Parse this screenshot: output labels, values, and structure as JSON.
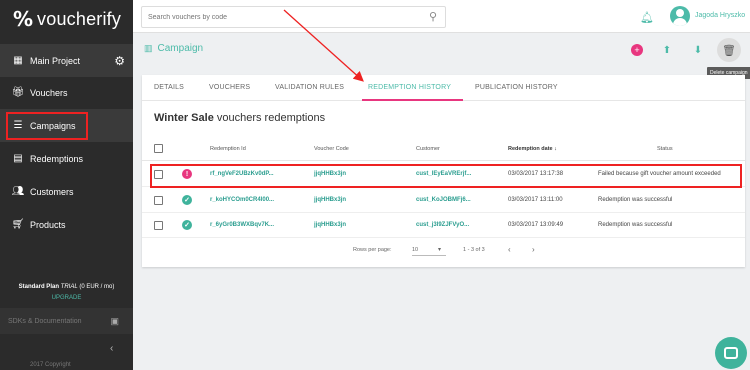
{
  "app": {
    "logo_mark": "%",
    "logo_text": "voucherify"
  },
  "sidebar": {
    "items": [
      {
        "label": "Main Project",
        "icon": "dashboard-icon"
      },
      {
        "label": "Vouchers",
        "icon": "gift-icon"
      },
      {
        "label": "Campaigns",
        "icon": "list-icon"
      },
      {
        "label": "Redemptions",
        "icon": "receipt-icon"
      },
      {
        "label": "Customers",
        "icon": "people-icon"
      },
      {
        "label": "Products",
        "icon": "cart-icon"
      }
    ],
    "plan_label": "Standard Plan",
    "plan_trial": "TRIAL",
    "plan_price": "(0 EUR / mo)",
    "upgrade": "UPGRADE",
    "sdk": "SDKs & Documentation",
    "copyright": "2017 Copyright"
  },
  "topbar": {
    "search_placeholder": "Search vouchers by code",
    "username": "Jagoda Hryszko"
  },
  "header": {
    "title": "Campaign",
    "tooltip": "Delete campaign"
  },
  "tabs": [
    "DETAILS",
    "VOUCHERS",
    "VALIDATION RULES",
    "REDEMPTION HISTORY",
    "PUBLICATION HISTORY"
  ],
  "active_tab": "REDEMPTION HISTORY",
  "card": {
    "title_bold": "Winter Sale",
    "title_rest": " vouchers redemptions"
  },
  "table": {
    "headers": {
      "redemption_id": "Redemption Id",
      "voucher_code": "Voucher Code",
      "customer": "Customer",
      "redemption_date": "Redemption date",
      "sort_icon": "↓",
      "status": "Status"
    },
    "rows": [
      {
        "status_type": "failed",
        "status_glyph": "!",
        "id": "rf_ngVeF2UBzKv0dP...",
        "code": "jjqHHBx3jn",
        "customer": "cust_lEyEaVRErjf...",
        "date": "03/03/2017 13:17:38",
        "status": "Failed because gift voucher amount exceeded"
      },
      {
        "status_type": "success",
        "status_glyph": "✓",
        "id": "r_koHYCOm0CR4l00...",
        "code": "jjqHHBx3jn",
        "customer": "cust_KoJOBMFj6...",
        "date": "03/03/2017 13:11:00",
        "status": "Redemption was successful"
      },
      {
        "status_type": "success",
        "status_glyph": "✓",
        "id": "r_6yGr0B3WXBqv7K...",
        "code": "jjqHHBx3jn",
        "customer": "cust_j3l9ZJFVyO...",
        "date": "03/03/2017 13:09:49",
        "status": "Redemption was successful"
      }
    ]
  },
  "pager": {
    "rows_per_page_label": "Rows per page:",
    "rows_per_page": "10",
    "range": "1 - 3 of 3",
    "prev": "‹",
    "next": "›"
  },
  "colors": {
    "accent": "#4dbba9",
    "pink": "#e8367f",
    "sidebar": "#2b2b2b",
    "annotation_red": "#e22"
  }
}
